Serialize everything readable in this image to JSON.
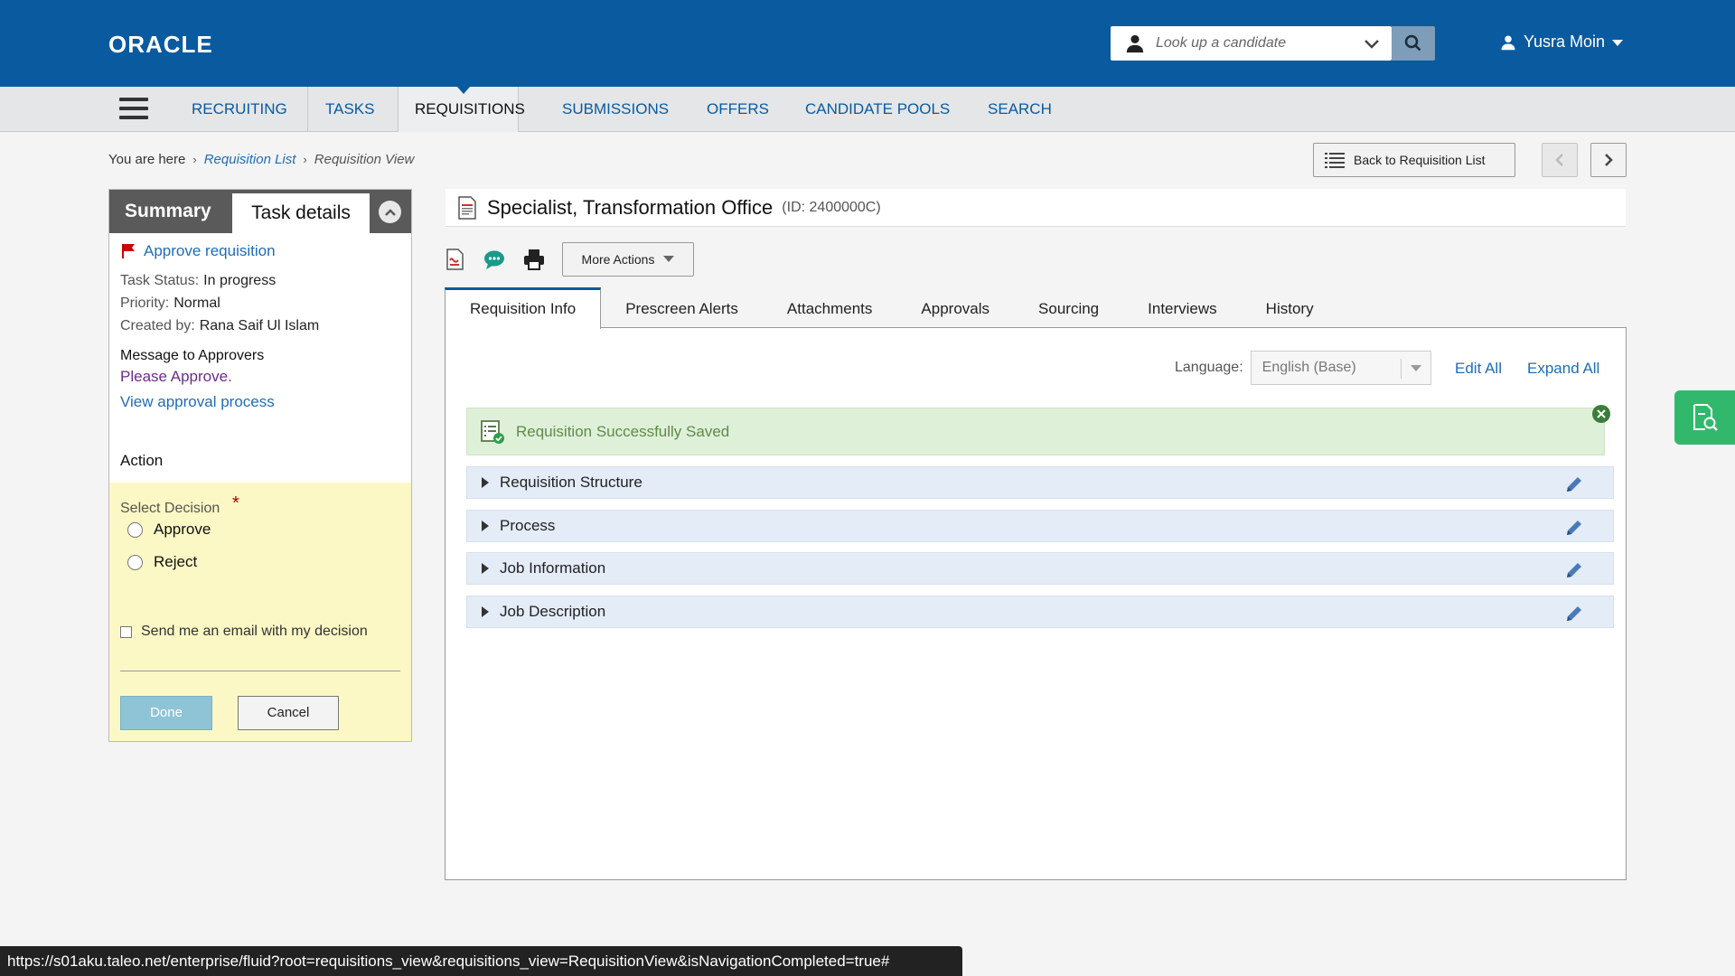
{
  "header": {
    "logo": "ORACLE",
    "lookup_placeholder": "Look up a candidate",
    "user_name": "Yusra Moin"
  },
  "nav": {
    "items": [
      "RECRUITING",
      "TASKS",
      "REQUISITIONS",
      "SUBMISSIONS",
      "OFFERS",
      "CANDIDATE POOLS",
      "SEARCH"
    ],
    "active": "REQUISITIONS"
  },
  "breadcrumb": {
    "prefix": "You are here",
    "link": "Requisition List",
    "current": "Requisition View"
  },
  "back_button": "Back to Requisition List",
  "left_panel": {
    "tab_summary": "Summary",
    "tab_task": "Task details",
    "task_title": "Approve requisition",
    "status_label": "Task Status:",
    "status_value": "In progress",
    "priority_label": "Priority:",
    "priority_value": "Normal",
    "created_label": "Created by:",
    "created_value": "Rana Saif Ul Islam",
    "message_label": "Message to Approvers",
    "message_value": "Please Approve.",
    "view_process": "View approval process",
    "action_label": "Action",
    "select_decision": "Select Decision",
    "required_mark": "*",
    "option_approve": "Approve",
    "option_reject": "Reject",
    "email_label": "Send me an email with my decision",
    "done": "Done",
    "cancel": "Cancel"
  },
  "requisition": {
    "title": "Specialist, Transformation Office",
    "id": "(ID: 2400000C)",
    "more_actions": "More Actions"
  },
  "tabs": [
    "Requisition Info",
    "Prescreen Alerts",
    "Attachments",
    "Approvals",
    "Sourcing",
    "Interviews",
    "History"
  ],
  "content": {
    "language_label": "Language:",
    "language_value": "English (Base)",
    "edit_all": "Edit All",
    "expand_all": "Expand All",
    "success_message": "Requisition Successfully Saved",
    "sections": [
      "Requisition Structure",
      "Process",
      "Job Information",
      "Job Description"
    ]
  },
  "status_url": "https://s01aku.taleo.net/enterprise/fluid?root=requisitions_view&requisitions_view=RequisitionView&isNavigationCompleted=true#",
  "colors": {
    "brand_blue": "#0a5aa0",
    "link_blue": "#1f6db6",
    "success_bg": "#dff0d8",
    "decision_bg": "#fbf8c5",
    "side_tab_green": "#32b86c"
  }
}
